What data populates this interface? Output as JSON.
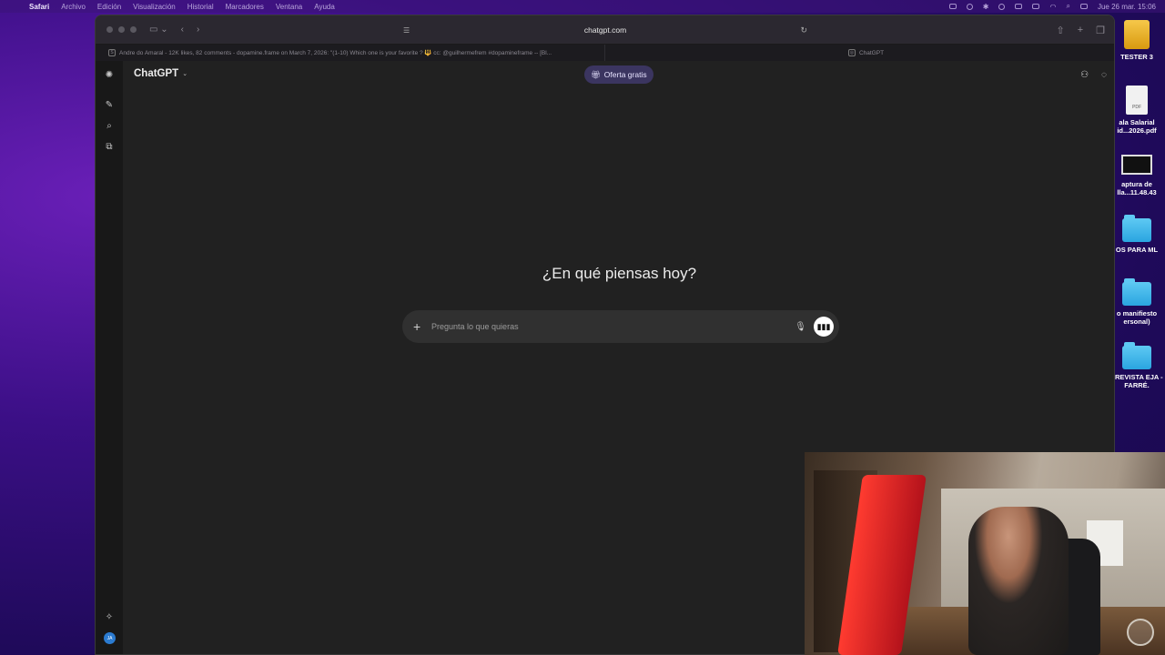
{
  "menubar": {
    "app": "Safari",
    "items": [
      "Archivo",
      "Edición",
      "Visualización",
      "Historial",
      "Marcadores",
      "Ventana",
      "Ayuda"
    ],
    "datetime": "Jue 26 mar.  15:06"
  },
  "desktop": {
    "items": [
      {
        "label": "TESTER 3",
        "icon": "drive-icon"
      },
      {
        "label": "ala Salarial id...2026.pdf",
        "icon": "pdf-icon"
      },
      {
        "label": "aptura de lla...11.48.43",
        "icon": "screenshot-icon"
      },
      {
        "label": "OS PARA ML",
        "icon": "folder-icon"
      },
      {
        "label": "o manifiesto ersonal)",
        "icon": "folder-icon"
      },
      {
        "label": "TREVISTA EJA - FARRÉ.",
        "icon": "folder-icon"
      }
    ]
  },
  "browser": {
    "url": "chatgpt.com",
    "tabs": [
      {
        "title": "Andre do Amaral - 12K likes, 82 comments - dopamine.frame on March 7, 2026: \"(1-10) Which one is your favorite ? 🔱 cc: @guilhermefrem #dopamineframe -- [Bl...",
        "favicon": "S"
      },
      {
        "title": "ChatGPT",
        "favicon": ""
      }
    ]
  },
  "chatgpt": {
    "model_label": "ChatGPT",
    "offer_label": "Oferta gratis",
    "greeting": "¿En qué piensas hoy?",
    "composer_placeholder": "Pregunta lo que quieras",
    "avatar_initials": "JA"
  },
  "colors": {
    "desktop_purple": "#3b0f86",
    "chat_bg": "#212121",
    "sidebar_bg": "#181818",
    "composer_bg": "#303030",
    "offer_bg": "#3b3560"
  }
}
